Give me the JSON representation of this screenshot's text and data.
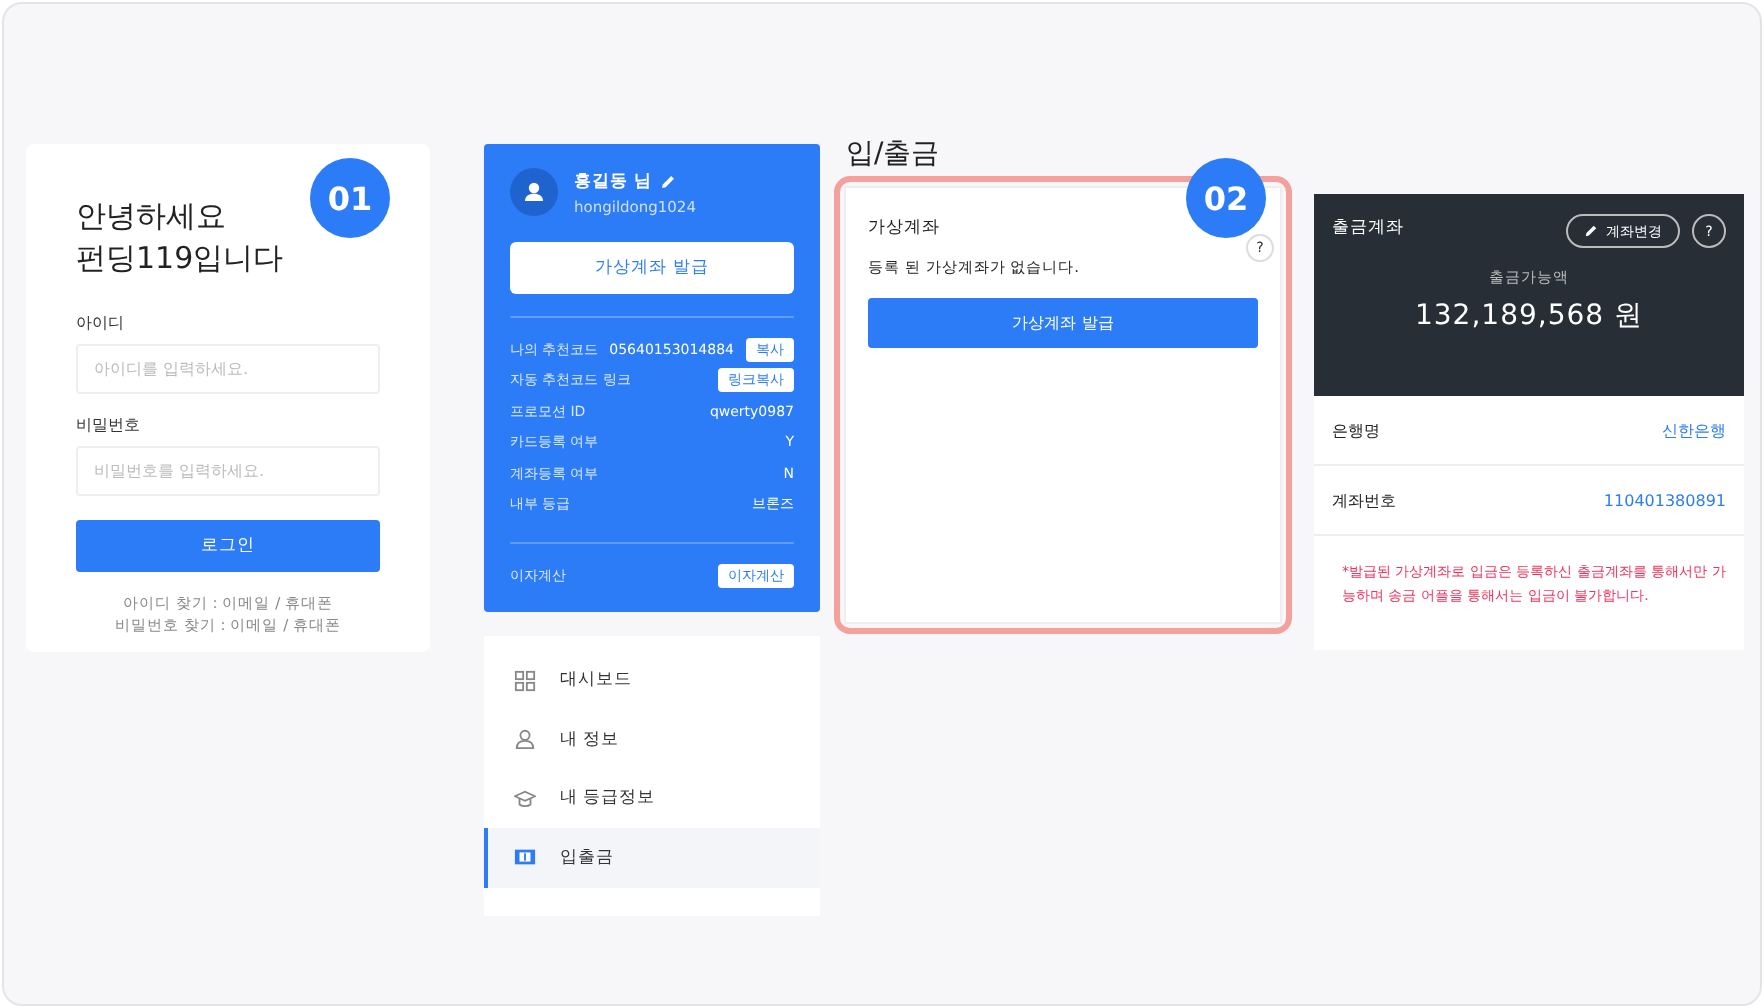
{
  "login": {
    "badge": "01",
    "greeting": [
      "안녕하세요",
      "펀딩119입니다"
    ],
    "fields": [
      {
        "label": "아이디",
        "placeholder": "아이디를 입력하세요."
      },
      {
        "label": "비밀번호",
        "placeholder": "비밀번호를 입력하세요."
      }
    ],
    "button": "로그인",
    "links": [
      "아이디 찾기 : 이메일 / 휴대폰",
      "비밀번호 찾기 : 이메일 / 휴대폰"
    ]
  },
  "profile": {
    "name": "홍길동 님",
    "user_id": "hongildong1024",
    "issue_button": "가상계좌 발급",
    "rows": [
      {
        "label": "나의 추천코드",
        "value": "05640153014884",
        "action": "복사"
      },
      {
        "label": "자동 추천코드 링크",
        "action": "링크복사"
      },
      {
        "label": "프로모션 ID",
        "value": "qwerty0987"
      },
      {
        "label": "카드등록 여부",
        "value": "Y"
      },
      {
        "label": "계좌등록 여부",
        "value": "N"
      },
      {
        "label": "내부 등급",
        "value": "브론즈"
      }
    ],
    "interest": {
      "label": "이자계산",
      "action": "이자계산"
    }
  },
  "menu": [
    {
      "label": "대시보드",
      "selected": false
    },
    {
      "label": "내 정보",
      "selected": false
    },
    {
      "label": "내 등급정보",
      "selected": false
    },
    {
      "label": "입출금",
      "selected": true
    }
  ],
  "deposit": {
    "title": "입/출금",
    "badge": "02",
    "card_title": "가상계좌",
    "help": "?",
    "message": "등록 된 가상계좌가 없습니다.",
    "button": "가상계좌 발급",
    "highlighted": true
  },
  "withdraw": {
    "title": "출금계좌",
    "change_button": "계좌변경",
    "help": "?",
    "balance_label": "출금가능액",
    "balance": "132,189,568 원",
    "rows": [
      {
        "label": "은행명",
        "value": "신한은행"
      },
      {
        "label": "계좌번호",
        "value": "110401380891"
      }
    ],
    "notice": "*발급된 가상계좌로 입금은 등록하신 출금계좌를 통해서만 가능하며 송금 어플을 통해서는 입금이 불가합니다."
  }
}
